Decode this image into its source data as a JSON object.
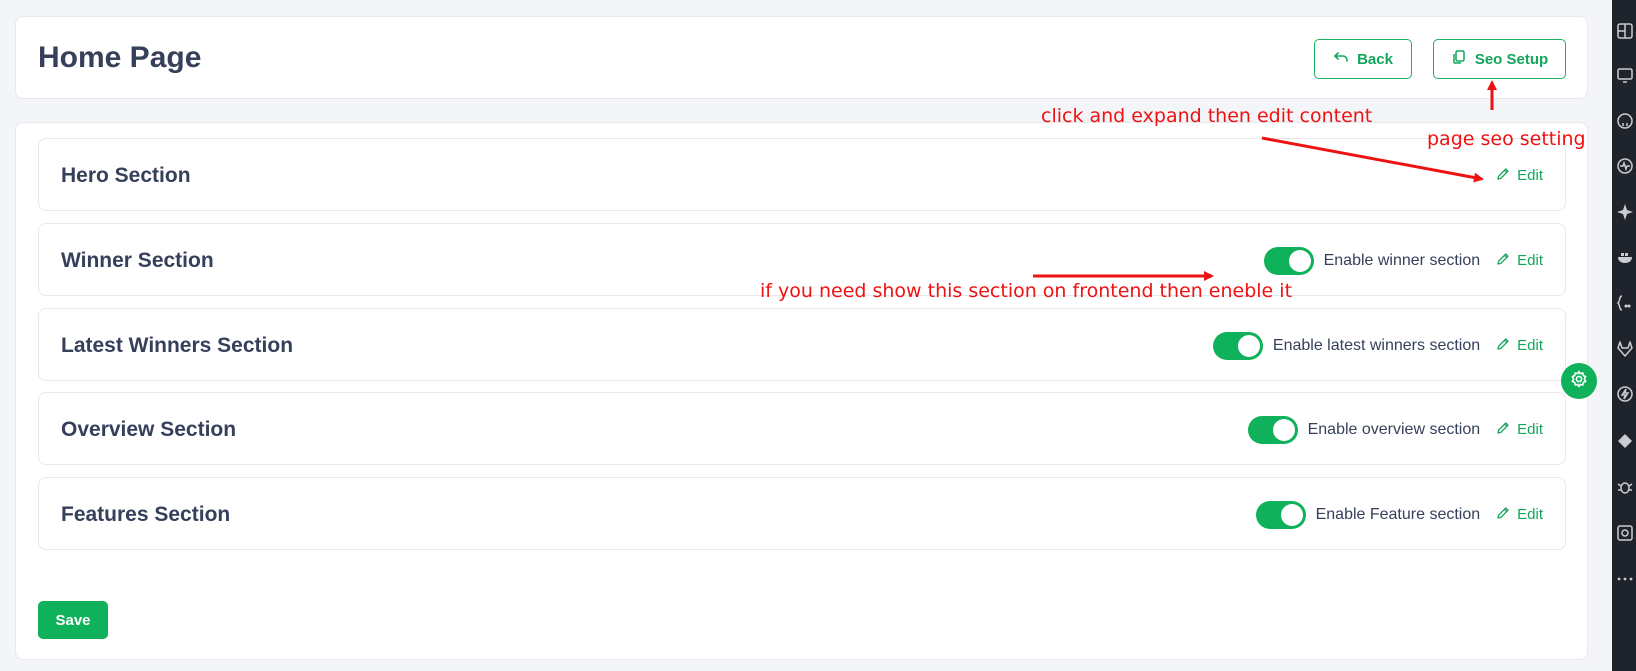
{
  "header": {
    "title": "Home Page",
    "back_label": "Back",
    "seo_label": "Seo Setup"
  },
  "sections": [
    {
      "title": "Hero Section",
      "has_toggle": false,
      "toggle_label": "",
      "enabled": false,
      "edit_label": "Edit"
    },
    {
      "title": "Winner Section",
      "has_toggle": true,
      "toggle_label": "Enable winner section",
      "enabled": true,
      "edit_label": "Edit"
    },
    {
      "title": "Latest Winners Section",
      "has_toggle": true,
      "toggle_label": "Enable latest winners section",
      "enabled": true,
      "edit_label": "Edit"
    },
    {
      "title": "Overview Section",
      "has_toggle": true,
      "toggle_label": "Enable overview section",
      "enabled": true,
      "edit_label": "Edit"
    },
    {
      "title": "Features Section",
      "has_toggle": true,
      "toggle_label": "Enable Feature section",
      "enabled": true,
      "edit_label": "Edit"
    }
  ],
  "save_label": "Save",
  "annotations": {
    "edit_hint": "click and expand then edit content",
    "seo_hint": "page seo setting",
    "toggle_hint": "if you need show this section on frontend then eneble it"
  },
  "colors": {
    "accent": "#0fb25b",
    "annotation": "#ee1212",
    "title_text": "#36405a",
    "page_bg": "#f4f5f8",
    "side_panel": "#1f232b"
  },
  "icons": {
    "back": "undo-arrow-icon",
    "seo": "copy-icon",
    "edit": "pencil-icon",
    "settings": "gear-icon"
  }
}
